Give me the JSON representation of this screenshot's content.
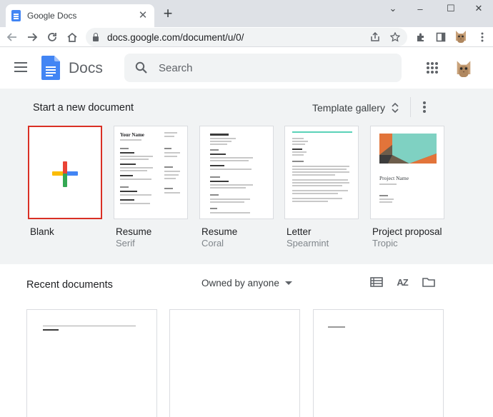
{
  "browser": {
    "tab_title": "Google Docs",
    "tab_close": "✕",
    "new_tab": "+",
    "url": "docs.google.com/document/u/0/",
    "window_controls": {
      "collapse": "⌄",
      "minimize": "–",
      "maximize": "☐",
      "close": "✕"
    }
  },
  "header": {
    "app_name": "Docs",
    "search_placeholder": "Search"
  },
  "templates": {
    "heading": "Start a new document",
    "gallery_label": "Template gallery",
    "items": [
      {
        "title": "Blank",
        "subtitle": ""
      },
      {
        "title": "Resume",
        "subtitle": "Serif",
        "preview_heading": "Your Name"
      },
      {
        "title": "Resume",
        "subtitle": "Coral"
      },
      {
        "title": "Letter",
        "subtitle": "Spearmint"
      },
      {
        "title": "Project proposal",
        "subtitle": "Tropic",
        "preview_heading": "Project Name"
      }
    ]
  },
  "recent": {
    "heading": "Recent documents",
    "owner_filter": "Owned by anyone",
    "sort_label": "AZ"
  },
  "colors": {
    "accent_blue": "#4285f4",
    "selection_red": "#d93025",
    "section_bg": "#f1f3f4",
    "plus_red": "#ea4335",
    "plus_yellow": "#fbbc04",
    "plus_green": "#34a853"
  },
  "icons": [
    "back-icon",
    "forward-icon",
    "reload-icon",
    "home-icon",
    "lock-icon",
    "share-icon",
    "star-icon",
    "extensions-icon",
    "side-panel-icon",
    "profile-avatar",
    "more-vert-icon",
    "menu-icon",
    "docs-logo-icon",
    "search-icon",
    "apps-grid-icon",
    "unfold-icon",
    "list-view-icon",
    "sort-az-icon",
    "folder-icon"
  ]
}
